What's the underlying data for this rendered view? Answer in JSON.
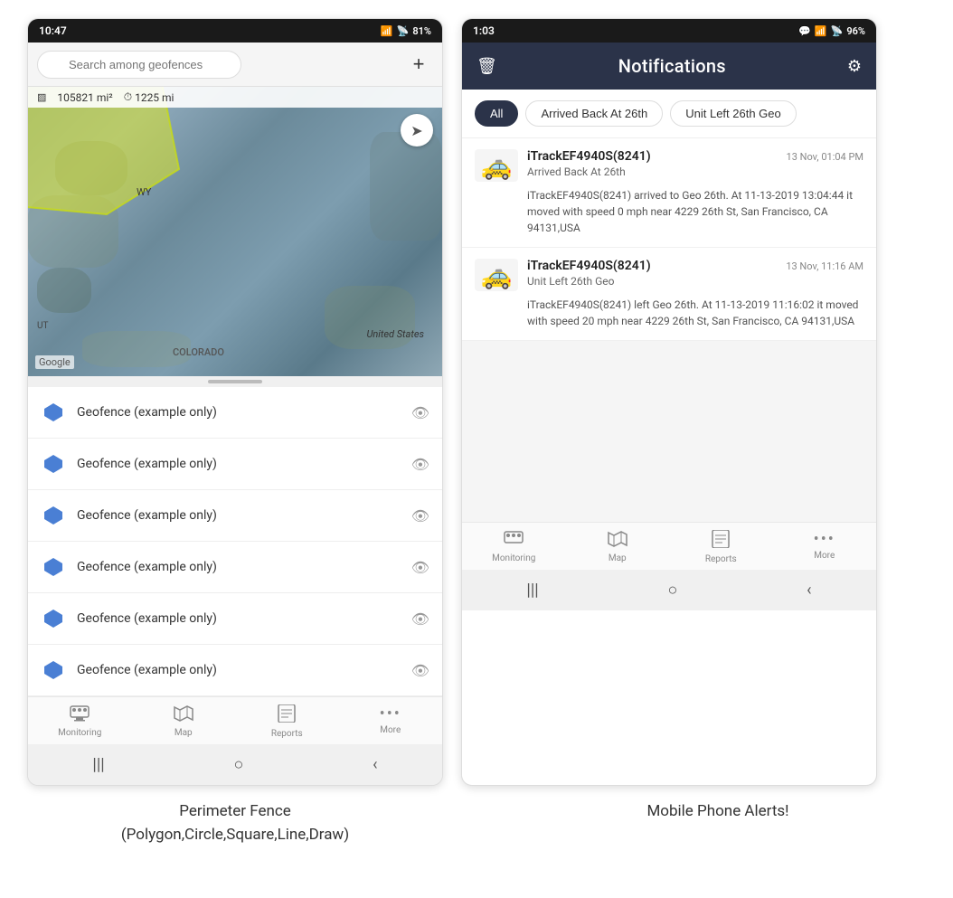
{
  "left_phone": {
    "status_bar": {
      "time": "10:47",
      "wifi": "WiFi",
      "signal": "Signal",
      "battery": "81%"
    },
    "search": {
      "placeholder": "Search among geofences"
    },
    "map": {
      "area": "105821 mi²",
      "distance": "1225 mi",
      "label_wy": "WY",
      "label_us": "United States",
      "label_co": "COLORADO",
      "label_ut": "UT",
      "google": "Google"
    },
    "geofence_items": [
      {
        "label": "Geofence (example only)"
      },
      {
        "label": "Geofence (example only)"
      },
      {
        "label": "Geofence (example only)"
      },
      {
        "label": "Geofence (example only)"
      },
      {
        "label": "Geofence (example only)"
      },
      {
        "label": "Geofence (example only)"
      }
    ],
    "nav_items": [
      {
        "icon": "🚌",
        "label": "Monitoring"
      },
      {
        "icon": "🗺",
        "label": "Map"
      },
      {
        "icon": "📊",
        "label": "Reports"
      },
      {
        "icon": "•••",
        "label": "More"
      }
    ],
    "android_nav": [
      "|||",
      "○",
      "‹"
    ]
  },
  "right_phone": {
    "status_bar": {
      "time": "1:03",
      "battery": "96%"
    },
    "header": {
      "title": "Notifications",
      "left_icon": "trash",
      "right_icon": "gear"
    },
    "filter_tabs": [
      {
        "label": "All",
        "active": true
      },
      {
        "label": "Arrived Back At 26th",
        "active": false
      },
      {
        "label": "Unit Left 26th Geo",
        "active": false
      }
    ],
    "notifications": [
      {
        "device": "iTrackEF4940S(8241)",
        "time": "13 Nov, 01:04 PM",
        "event": "Arrived Back At 26th",
        "body": "iTrackEF4940S(8241) arrived to Geo 26th.   At 11-13-2019 13:04:44 it moved with speed 0 mph near 4229 26th St, San Francisco, CA 94131,USA"
      },
      {
        "device": "iTrackEF4940S(8241)",
        "time": "13 Nov, 11:16 AM",
        "event": "Unit Left 26th Geo",
        "body": "iTrackEF4940S(8241) left Geo 26th.   At 11-13-2019 11:16:02 it moved with speed 20 mph near 4229 26th St, San Francisco, CA 94131,USA"
      }
    ],
    "nav_items": [
      {
        "icon": "🚌",
        "label": "Monitoring"
      },
      {
        "icon": "🗺",
        "label": "Map"
      },
      {
        "icon": "📊",
        "label": "Reports"
      },
      {
        "icon": "•••",
        "label": "More"
      }
    ],
    "android_nav": [
      "|||",
      "○",
      "‹"
    ]
  },
  "captions": {
    "left": "Perimeter Fence\n(Polygon,Circle,Square,Line,Draw)",
    "right": "Mobile Phone Alerts!"
  }
}
